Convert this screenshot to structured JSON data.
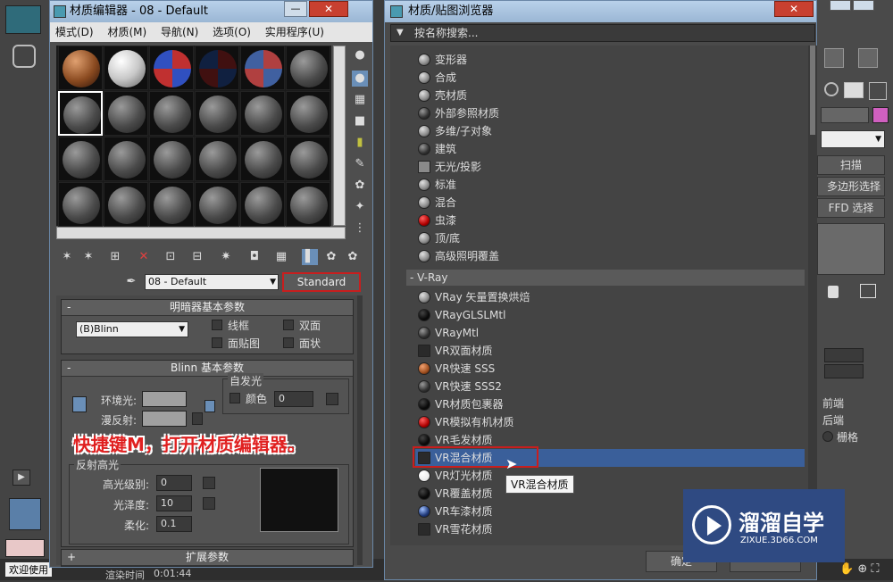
{
  "background": {
    "right_buttons": [
      "扫描",
      "多边形选择",
      "FFD 选择"
    ],
    "right_labels": [
      "前端",
      "后端",
      "栅格"
    ],
    "status_text": "欢迎使用",
    "render_time_label": "渲染时间",
    "render_time_value": "0:01:44",
    "bottom_button": "确定"
  },
  "material_editor": {
    "title": "材质编辑器 - 08 - Default",
    "menu": [
      "模式(D)",
      "材质(M)",
      "导航(N)",
      "选项(O)",
      "实用程序(U)"
    ],
    "material_name": "08 - Default",
    "material_type": "Standard",
    "shader_rollout": {
      "title": "明暗器基本参数",
      "shader": "(B)Blinn",
      "options": [
        "线框",
        "双面",
        "面贴图",
        "面状"
      ]
    },
    "blinn_rollout": {
      "title": "Blinn 基本参数",
      "ambient": "环境光:",
      "diffuse": "漫反射:",
      "self_illum": "自发光",
      "color_label": "颜色",
      "color_value": "0",
      "specular_title": "反射高光",
      "spec_level_label": "高光级别:",
      "spec_level": "0",
      "glossiness_label": "光泽度:",
      "glossiness": "10",
      "soften_label": "柔化:",
      "soften": "0.1"
    },
    "extended_rollout": "扩展参数"
  },
  "annotation": "快捷键M，打开材质编辑器。",
  "browser": {
    "title": "材质/贴图浏览器",
    "search_placeholder": "按名称搜索...",
    "standard_items": [
      {
        "label": "变形器",
        "icon": "sphere-gray"
      },
      {
        "label": "合成",
        "icon": "sphere-gray"
      },
      {
        "label": "壳材质",
        "icon": "sphere-gray"
      },
      {
        "label": "外部参照材质",
        "icon": "sphere-dark"
      },
      {
        "label": "多维/子对象",
        "icon": "sphere-gray"
      },
      {
        "label": "建筑",
        "icon": "sphere-dark"
      },
      {
        "label": "无光/投影",
        "icon": "square-gray"
      },
      {
        "label": "标准",
        "icon": "sphere-gray"
      },
      {
        "label": "混合",
        "icon": "sphere-gray"
      },
      {
        "label": "虫漆",
        "icon": "sphere-red"
      },
      {
        "label": "顶/底",
        "icon": "sphere-gray"
      },
      {
        "label": "高级照明覆盖",
        "icon": "sphere-gray"
      }
    ],
    "vray_group": "- V-Ray",
    "vray_items": [
      {
        "label": "VRay 矢量置换烘焙",
        "icon": "sphere-gray"
      },
      {
        "label": "VRayGLSLMtl",
        "icon": "sphere-black"
      },
      {
        "label": "VRayMtl",
        "icon": "sphere-dark"
      },
      {
        "label": "VR双面材质",
        "icon": "square-dark"
      },
      {
        "label": "VR快速 SSS",
        "icon": "sphere-orange"
      },
      {
        "label": "VR快速 SSS2",
        "icon": "sphere-dark"
      },
      {
        "label": "VR材质包裹器",
        "icon": "sphere-black"
      },
      {
        "label": "VR模拟有机材质",
        "icon": "sphere-red"
      },
      {
        "label": "VR毛发材质",
        "icon": "sphere-black"
      },
      {
        "label": "VR混合材质",
        "icon": "square-dark"
      },
      {
        "label": "VR灯光材质",
        "icon": "sphere-white"
      },
      {
        "label": "VR覆盖材质",
        "icon": "sphere-black"
      },
      {
        "label": "VR车漆材质",
        "icon": "sphere-blue"
      },
      {
        "label": "VR雪花材质",
        "icon": "square-dark"
      }
    ],
    "selected_item": "VR混合材质",
    "tooltip": "VR混合材质"
  },
  "watermark": {
    "brand": "溜溜自学",
    "url": "ZIXUE.3D66.COM"
  },
  "colors": {
    "highlight": "#3a5f9a",
    "red_box": "#c81e1e",
    "accent_pink": "#d060c0",
    "watermark_bg": "#2f4a82"
  }
}
